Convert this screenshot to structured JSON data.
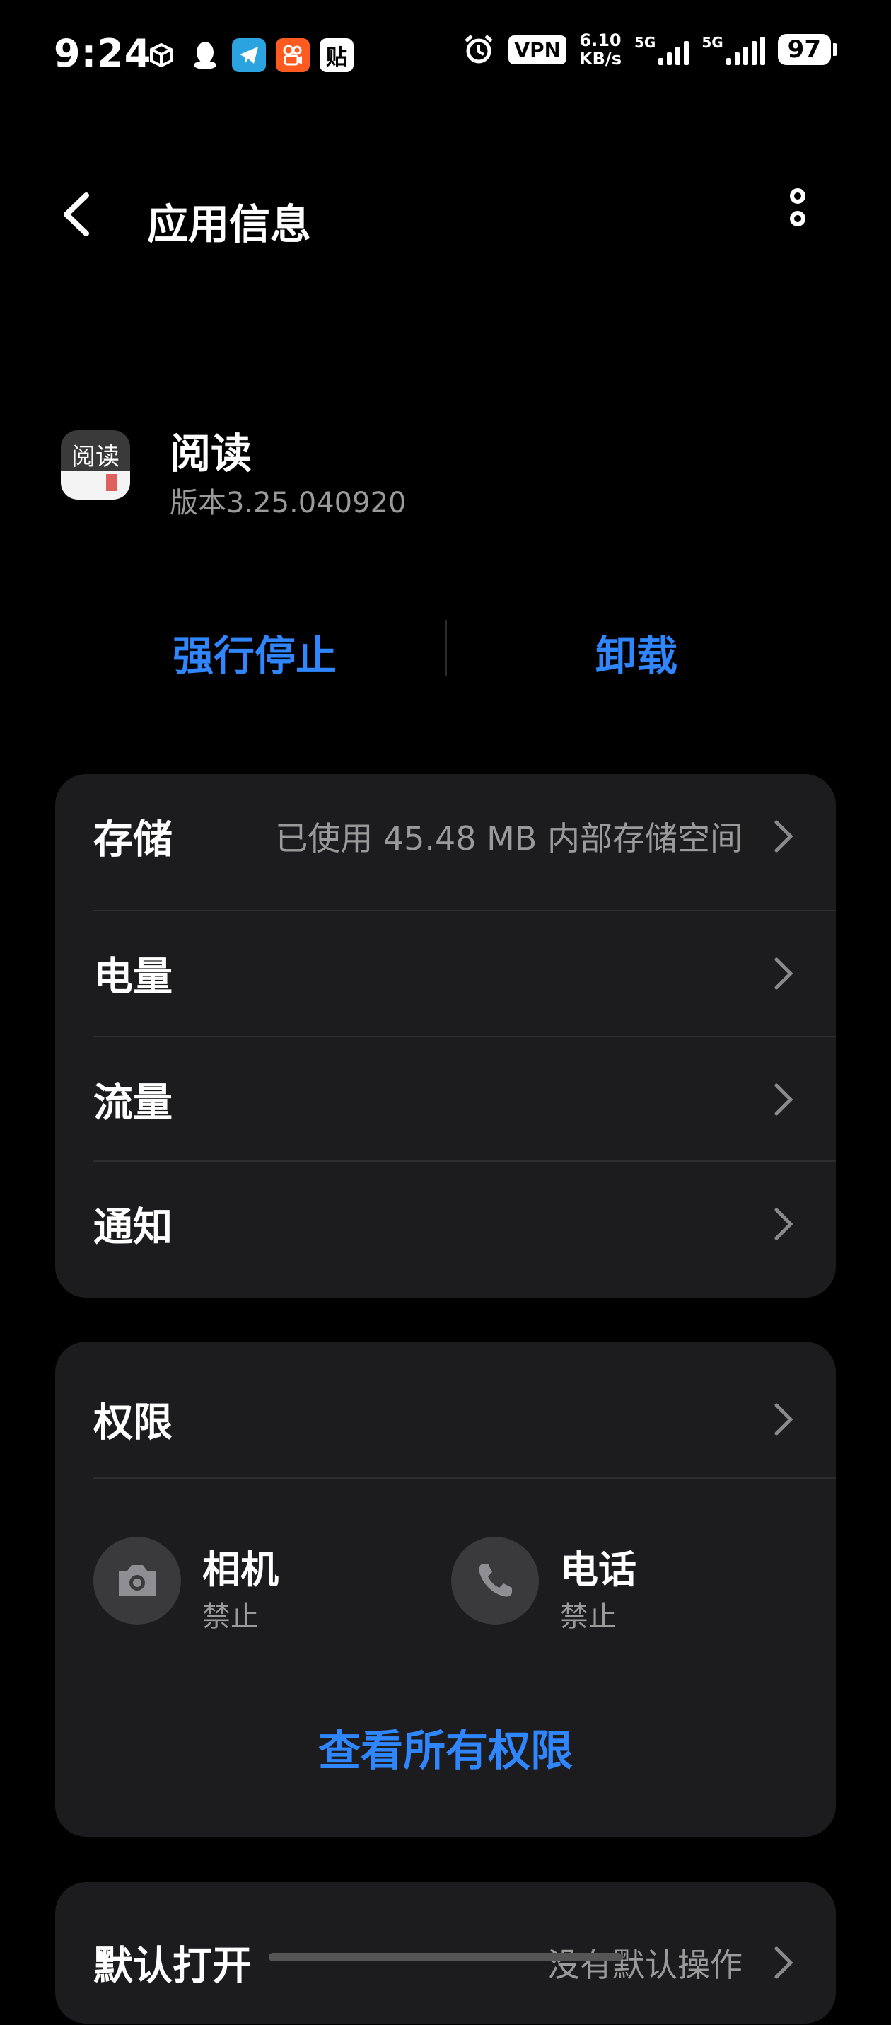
{
  "status_bar": {
    "time": "9:24",
    "vpn": "VPN",
    "speed_value": "6.10",
    "speed_unit": "KB/s",
    "net1": "5G",
    "net2": "5G",
    "battery": "97",
    "notification_icons": [
      "box-icon",
      "qq-icon",
      "telegram-icon",
      "kuaishou-icon",
      "tieba-icon"
    ]
  },
  "header": {
    "title": "应用信息"
  },
  "app": {
    "name": "阅读",
    "version": "版本3.25.040920",
    "icon_glyph": "阅读"
  },
  "actions": {
    "force_stop": "强行停止",
    "uninstall": "卸载"
  },
  "card1": {
    "storage_label": "存储",
    "storage_value": "已使用 45.48 MB 内部存储空间",
    "battery_label": "电量",
    "data_label": "流量",
    "notify_label": "通知"
  },
  "card2": {
    "permissions_label": "权限",
    "camera_name": "相机",
    "camera_status": "禁止",
    "phone_name": "电话",
    "phone_status": "禁止",
    "view_all": "查看所有权限"
  },
  "card3": {
    "default_open_label": "默认打开",
    "default_open_value": "没有默认操作"
  },
  "colors": {
    "accent": "#2f86ff",
    "card": "#1c1c1e",
    "background": "#000000",
    "secondary_text": "#9a9a9a"
  }
}
